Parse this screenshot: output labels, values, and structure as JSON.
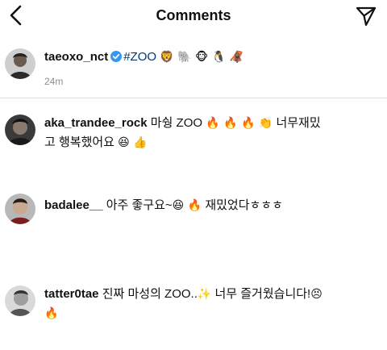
{
  "header": {
    "title": "Comments",
    "back_icon": "chevron-left-icon",
    "send_icon": "paper-plane-icon"
  },
  "caption": {
    "username": "taeoxo_nct",
    "text": "#ZOO",
    "emojis": "🦁 🐘 🐵 🐧 🦧",
    "time": "24m",
    "verified_color": "#3897f0"
  },
  "comments": [
    {
      "username": "aka_trandee_rock",
      "text_line1": "마쉉 ZOO",
      "emojis_line1": "🔥 🔥 🔥 👏",
      "text_line1b": "너무재밌",
      "text_line2": "고 행복했어요",
      "emojis_line2": "😆 👍"
    },
    {
      "username": "badalee__",
      "text_a": "아주 좋구요~",
      "emojis_a": "😆 🔥",
      "text_b": "재밌었다ㅎㅎㅎ"
    },
    {
      "username": "tatter0tae",
      "text_a": "진짜 마성의 ZOO..",
      "emojis_a": "✨",
      "text_b": "너무 즐거웠습니다!",
      "emojis_b": "😣",
      "emojis_line2": "🔥"
    }
  ],
  "colors": {
    "text": "#111111",
    "muted": "#8e8e8e",
    "hashtag": "#00376b",
    "divider": "#dbdbdb"
  }
}
